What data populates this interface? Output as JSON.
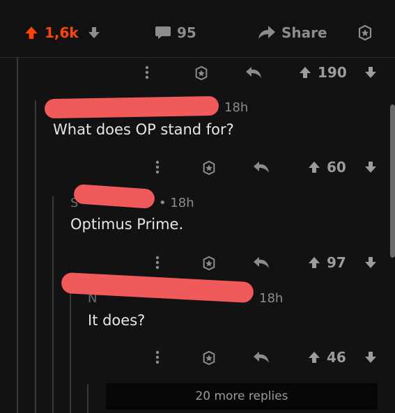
{
  "post": {
    "score": "1,6k",
    "comments": "95",
    "share_label": "Share"
  },
  "comments": [
    {
      "score": "190"
    },
    {
      "time": "18h",
      "body": "What does OP stand for?",
      "score": "60"
    },
    {
      "author_partial": "S",
      "time": "• 18h",
      "body": "Optimus Prime.",
      "score": "97"
    },
    {
      "author_partial": "N",
      "time": "18h",
      "body": "It does?",
      "score": "46"
    }
  ],
  "more_replies": "20 more replies",
  "colors": {
    "accent": "#ff4500",
    "redaction": "#f05a5a",
    "background": "#121212"
  },
  "icons": [
    "upvote-arrow-icon",
    "downvote-arrow-icon",
    "comment-bubble-icon",
    "share-arrow-icon",
    "award-icon",
    "overflow-dots-icon",
    "reply-arrow-icon"
  ]
}
